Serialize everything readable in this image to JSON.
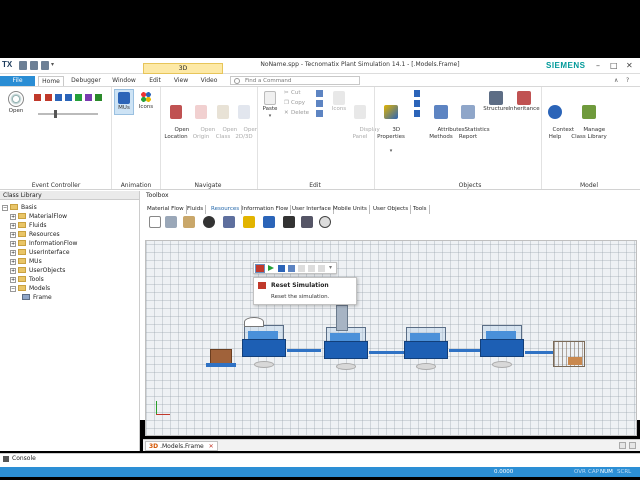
{
  "app": {
    "logo": "TX",
    "title": "NoName.spp - Tecnomatix Plant Simulation 14.1 - [.Models.Frame]",
    "brand": "SIEMENS",
    "context_tab": "3D"
  },
  "ribbon_tabs": [
    "File",
    "Home",
    "Debugger",
    "Window",
    "Edit",
    "View",
    "Video"
  ],
  "search": {
    "placeholder": "Find a Command"
  },
  "ribbon": {
    "open": "Open",
    "mus": "MUs",
    "icons": "Icons",
    "open_location": "Open\nLocation",
    "open_origin": "Open\nOrigin",
    "open_class": "Open\nClass",
    "open_2d3d": "Open\n2D/3D",
    "paste": "Paste",
    "cut": "Cut",
    "copy": "Copy",
    "delete": "Delete",
    "icons2": "Icons",
    "display_panel": "Display\nPanel",
    "three_d_properties": "3D\nProperties",
    "attributes_methods": "Attributes\nMethods",
    "statistics_report": "Statistics\nReport",
    "structure": "Structure",
    "inheritance": "Inheritance",
    "context_help": "Context\nHelp",
    "manage_class_library": "Manage\nClass Library",
    "groups": {
      "event_controller": "Event Controller",
      "animation": "Animation",
      "navigate": "Navigate",
      "edit": "Edit",
      "objects": "Objects",
      "model": "Model"
    }
  },
  "class_library": {
    "title": "Class Library",
    "items": [
      "Basis",
      "MaterialFlow",
      "Fluids",
      "Resources",
      "InformationFlow",
      "UserInterface",
      "MUs",
      "UserObjects",
      "Tools",
      "Models",
      "Frame"
    ]
  },
  "toolbox": {
    "title": "Toolbox",
    "tabs": [
      "Material Flow",
      "Fluids",
      "Resources",
      "Information Flow",
      "User Interface",
      "Mobile Units",
      "User Objects",
      "Tools"
    ]
  },
  "tooltip": {
    "title": "Reset Simulation",
    "description": "Reset the simulation."
  },
  "doc_tab": {
    "label": ".Models.Frame",
    "prefix": "3D"
  },
  "console": {
    "label": "Console"
  },
  "status": {
    "time": "0.0000",
    "indicators": [
      "OVR",
      "CAP",
      "NUM",
      "SCRL"
    ]
  },
  "colors": {
    "accent": "#2c8fd5",
    "brand": "#009999",
    "station_blue": "#1d5fb4"
  }
}
